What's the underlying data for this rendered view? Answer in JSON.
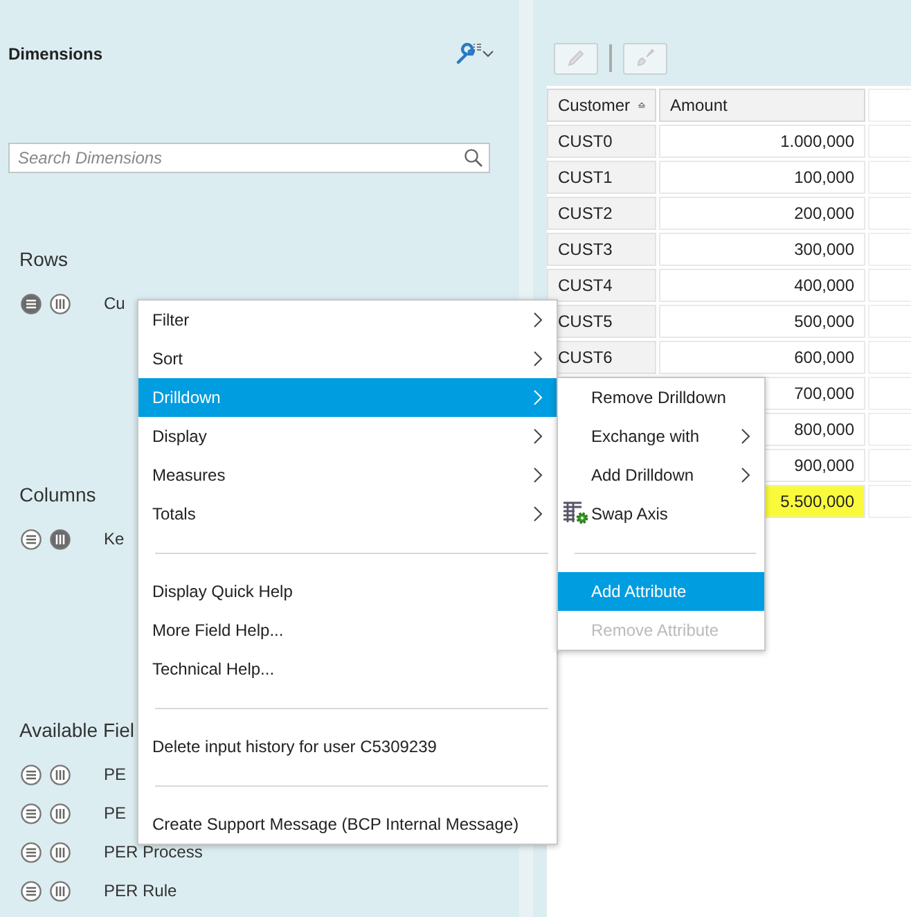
{
  "dimensions_panel": {
    "title": "Dimensions",
    "search": {
      "placeholder": "Search Dimensions"
    },
    "sections": [
      {
        "title": "Rows",
        "items": [
          {
            "label": "Cu",
            "rows_active": true,
            "columns_active": false
          }
        ]
      },
      {
        "title": "Columns",
        "items": [
          {
            "label": "Ke",
            "rows_active": false,
            "columns_active": true
          }
        ]
      },
      {
        "title": "Available Fiel",
        "items": [
          {
            "label": "PE",
            "rows_active": false,
            "columns_active": false
          },
          {
            "label": "PE",
            "rows_active": false,
            "columns_active": false
          },
          {
            "label": "PER Process",
            "rows_active": false,
            "columns_active": false
          },
          {
            "label": "PER Rule",
            "rows_active": false,
            "columns_active": false
          }
        ]
      }
    ]
  },
  "toolbar": {
    "buttons": [
      {
        "kind": "edit",
        "disabled": true
      },
      {
        "kind": "brush",
        "disabled": true
      }
    ]
  },
  "table": {
    "columns": [
      "Customer",
      "Amount"
    ],
    "rows": [
      {
        "customer": "CUST0",
        "amount": "1.000,000",
        "total": false
      },
      {
        "customer": "CUST1",
        "amount": "100,000",
        "total": false
      },
      {
        "customer": "CUST2",
        "amount": "200,000",
        "total": false
      },
      {
        "customer": "CUST3",
        "amount": "300,000",
        "total": false
      },
      {
        "customer": "CUST4",
        "amount": "400,000",
        "total": false
      },
      {
        "customer": "CUST5",
        "amount": "500,000",
        "total": false
      },
      {
        "customer": "CUST6",
        "amount": "600,000",
        "total": false
      },
      {
        "amount": "700,000",
        "total": false
      },
      {
        "amount": "800,000",
        "total": false
      },
      {
        "amount": "900,000",
        "total": false
      },
      {
        "amount": "5.500,000",
        "total": true
      }
    ]
  },
  "context_menu": {
    "items": [
      {
        "kind": "item",
        "label": "Filter",
        "submenu": true,
        "selected": false
      },
      {
        "kind": "item",
        "label": "Sort",
        "submenu": true,
        "selected": false
      },
      {
        "kind": "item",
        "label": "Drilldown",
        "submenu": true,
        "selected": true
      },
      {
        "kind": "item",
        "label": "Display",
        "submenu": true,
        "selected": false
      },
      {
        "kind": "item",
        "label": "Measures",
        "submenu": true,
        "selected": false
      },
      {
        "kind": "item",
        "label": "Totals",
        "submenu": true,
        "selected": false
      },
      {
        "kind": "separator"
      },
      {
        "kind": "item",
        "label": "Display Quick Help",
        "submenu": false,
        "selected": false
      },
      {
        "kind": "item",
        "label": "More Field Help...",
        "submenu": false,
        "selected": false
      },
      {
        "kind": "item",
        "label": "Technical Help...",
        "submenu": false,
        "selected": false
      },
      {
        "kind": "separator"
      },
      {
        "kind": "item",
        "label": "Delete input history for user C5309239",
        "submenu": false,
        "selected": false
      },
      {
        "kind": "separator"
      },
      {
        "kind": "item",
        "label": "Create Support Message (BCP Internal Message)",
        "submenu": false,
        "selected": false
      }
    ]
  },
  "submenu": {
    "items": [
      {
        "kind": "item",
        "label": "Remove Drilldown",
        "submenu": false,
        "selected": false,
        "disabled": false
      },
      {
        "kind": "item",
        "label": "Exchange with",
        "submenu": true,
        "selected": false,
        "disabled": false
      },
      {
        "kind": "item",
        "label": "Add Drilldown",
        "submenu": true,
        "selected": false,
        "disabled": false
      },
      {
        "kind": "icon-item",
        "label": "Swap Axis",
        "submenu": false,
        "selected": false,
        "disabled": false
      },
      {
        "kind": "separator"
      },
      {
        "kind": "item",
        "label": "Add Attribute",
        "submenu": false,
        "selected": true,
        "disabled": false
      },
      {
        "kind": "item",
        "label": "Remove Attribute",
        "submenu": false,
        "selected": false,
        "disabled": true
      }
    ]
  }
}
